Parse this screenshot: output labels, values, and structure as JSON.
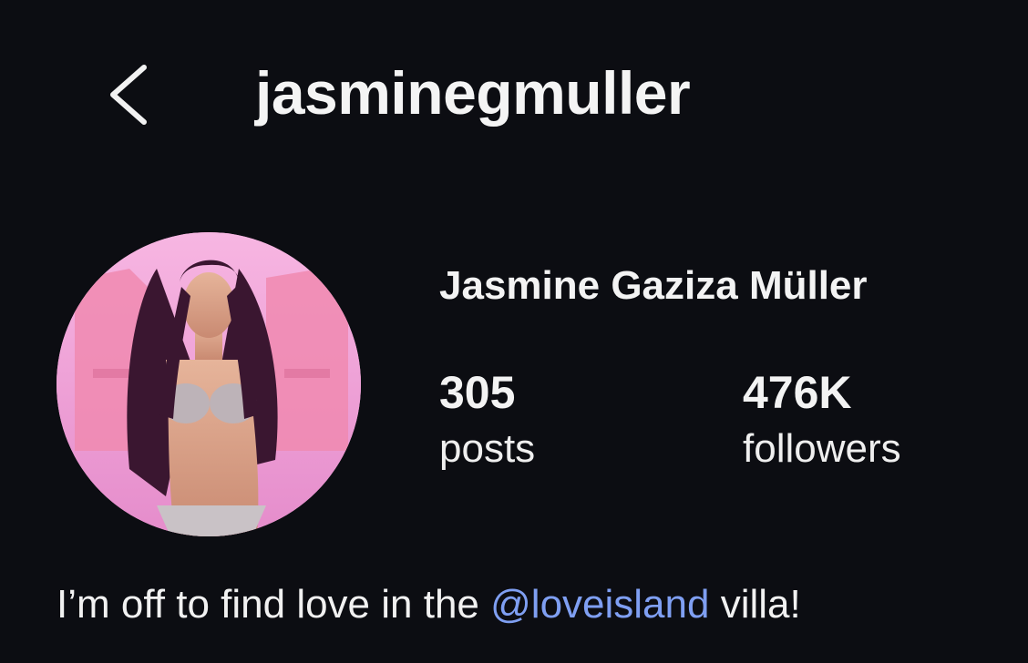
{
  "header": {
    "back_icon": "chevron-left-icon",
    "username": "jasminegmuller"
  },
  "profile": {
    "full_name": "Jasmine Gaziza Müller",
    "avatar_background": "#f3a6d8",
    "stats": {
      "posts": {
        "count": "305",
        "label": "posts"
      },
      "followers": {
        "count": "476K",
        "label": "followers"
      }
    },
    "bio": {
      "before": "I’m off to find love in the ",
      "mention": "@loveisland",
      "after": " villa!",
      "mention_color": "#7f9ff2"
    }
  }
}
